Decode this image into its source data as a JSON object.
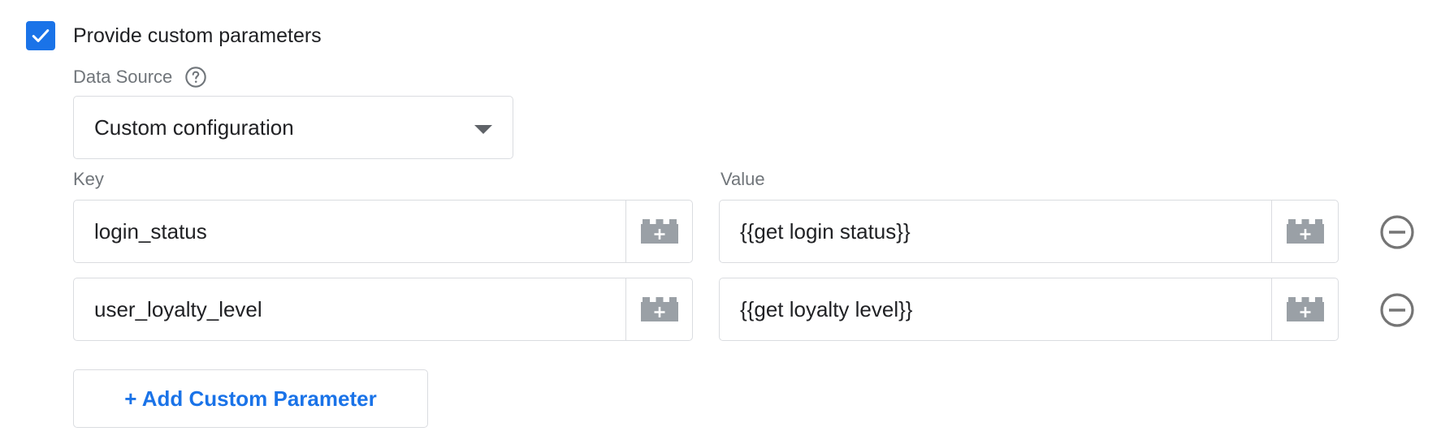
{
  "checkbox": {
    "checked": true,
    "label": "Provide custom parameters"
  },
  "data_source": {
    "label": "Data Source",
    "help_icon": "help-circle-icon",
    "selected": "Custom configuration"
  },
  "columns": {
    "key_label": "Key",
    "value_label": "Value"
  },
  "rows": [
    {
      "key": "login_status",
      "value": "{{get login status}}"
    },
    {
      "key": "user_loyalty_level",
      "value": "{{get loyalty level}}"
    }
  ],
  "icons": {
    "variable_picker": "variable-brick-icon",
    "remove": "remove-circle-icon",
    "dropdown": "chevron-down-icon",
    "check": "check-icon"
  },
  "add_button": {
    "label": "+ Add Custom Parameter"
  },
  "colors": {
    "accent": "#1a73e8",
    "border": "#dadce0",
    "label": "#70757a",
    "text": "#202124",
    "icon": "#9aa0a6"
  }
}
